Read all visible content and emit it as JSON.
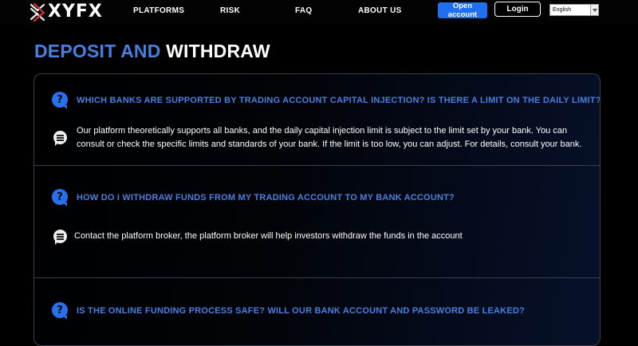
{
  "header": {
    "logo_text": "XYFX",
    "nav": [
      "PLATFORMS",
      "RISK",
      "FAQ",
      "ABOUT US"
    ],
    "open_account_label": "Open account",
    "login_label": "Login",
    "language_selected": "English"
  },
  "page": {
    "title_part1": "DEPOSIT AND",
    "title_part2": "WITHDRAW"
  },
  "faq": [
    {
      "question": "WHICH BANKS ARE SUPPORTED BY TRADING ACCOUNT CAPITAL INJECTION? IS THERE A LIMIT ON THE DAILY LIMIT?",
      "answer": "Our platform theoretically supports all banks, and the daily capital injection limit is subject to the limit set by your bank. You can consult or check the specific limits and standards of your bank. If the limit is too low, you can adjust. For details, consult your bank."
    },
    {
      "question": "HOW DO I WITHDRAW FUNDS FROM MY TRADING ACCOUNT TO MY BANK ACCOUNT?",
      "answer": "Contact the platform broker, the platform broker will help investors withdraw the funds in the account"
    },
    {
      "question": "IS THE ONLINE FUNDING PROCESS SAFE? WILL OUR BANK ACCOUNT AND PASSWORD BE LEAKED?",
      "answer": ""
    }
  ],
  "colors": {
    "accent": "#4a7fe0",
    "button_blue": "#1f6ff0",
    "background": "#000000"
  }
}
